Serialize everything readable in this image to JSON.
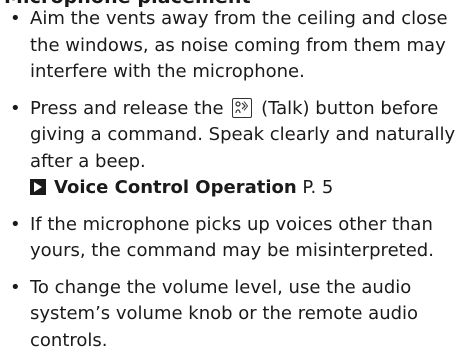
{
  "header_fragment": "Microphone placement",
  "bullets": [
    {
      "text": "Aim the vents away from the ceiling and close the windows, as noise coming from them may interfere with the microphone."
    },
    {
      "before_icon": "Press and release the",
      "icon": "talk-button-icon",
      "after_icon": "(Talk) button before giving a command. Speak clearly and naturally after a beep.",
      "reference": {
        "title": "Voice Control Operation",
        "page": "P. 5"
      }
    },
    {
      "text": "If the microphone picks up voices other than yours, the command may be misinterpreted."
    },
    {
      "text": "To change the volume level, use the audio system’s volume knob or the remote audio controls."
    }
  ],
  "bullet_glyph": "•"
}
